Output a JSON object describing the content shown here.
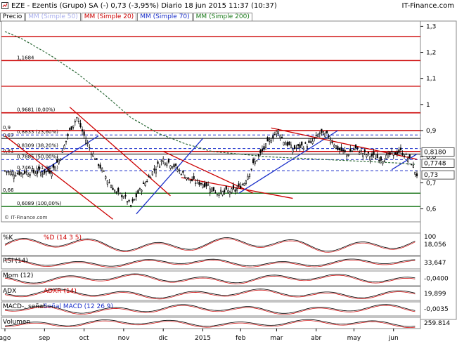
{
  "header": {
    "title": "EZE - Ezentis (Grupo) SA (-)   0,73 (-3,95%)   Diario  18 jun 2015 11:37 (10:37)",
    "brand": "IT-Finance.com"
  },
  "legend": {
    "precio": "Precio",
    "mm50": "MM (Simple 50)",
    "mm20": "MM (Simple 20)",
    "mm70": "MM (Simple 70)",
    "mm200": "MM (Simple 200)"
  },
  "colors": {
    "price": "#000000",
    "up": "#ffffff",
    "down": "#000000",
    "red": "#cc0000",
    "blue": "#1a2fc9",
    "green": "#1b7a1b",
    "mm200": "#2f6b3a",
    "label_box": "#ffffff"
  },
  "chart_data": {
    "type": "candlestick",
    "ylim": [
      0.55,
      1.32
    ],
    "yticks": [
      "1,3",
      "1,2",
      "1,1",
      "1",
      "0,9",
      "0,8",
      "0,7",
      "0,6"
    ],
    "ytick_values": [
      1.3,
      1.2,
      1.1,
      1.0,
      0.9,
      0.8,
      0.7,
      0.6
    ],
    "xticks": [
      "ago",
      "sep",
      "oct",
      "nov",
      "dic",
      "2015",
      "feb",
      "mar",
      "abr",
      "may",
      "jun"
    ],
    "xtick_index": [
      0,
      22,
      44,
      66,
      88,
      110,
      131,
      151,
      173,
      194,
      216
    ],
    "price_path": [
      [
        0,
        0.745
      ],
      [
        6,
        0.735
      ],
      [
        11,
        0.74
      ],
      [
        16,
        0.74
      ],
      [
        21,
        0.74
      ],
      [
        26,
        0.745
      ],
      [
        31,
        0.8
      ],
      [
        36,
        0.9
      ],
      [
        40,
        0.95
      ],
      [
        44,
        0.88
      ],
      [
        48,
        0.82
      ],
      [
        53,
        0.76
      ],
      [
        58,
        0.7
      ],
      [
        62,
        0.66
      ],
      [
        66,
        0.65
      ],
      [
        70,
        0.61
      ],
      [
        74,
        0.66
      ],
      [
        78,
        0.7
      ],
      [
        83,
        0.75
      ],
      [
        88,
        0.79
      ],
      [
        93,
        0.77
      ],
      [
        98,
        0.74
      ],
      [
        103,
        0.71
      ],
      [
        108,
        0.7
      ],
      [
        113,
        0.69
      ],
      [
        118,
        0.66
      ],
      [
        123,
        0.665
      ],
      [
        128,
        0.67
      ],
      [
        133,
        0.7
      ],
      [
        138,
        0.77
      ],
      [
        143,
        0.82
      ],
      [
        148,
        0.87
      ],
      [
        152,
        0.9
      ],
      [
        155,
        0.86
      ],
      [
        160,
        0.83
      ],
      [
        165,
        0.84
      ],
      [
        170,
        0.85
      ],
      [
        175,
        0.89
      ],
      [
        180,
        0.88
      ],
      [
        185,
        0.83
      ],
      [
        190,
        0.81
      ],
      [
        195,
        0.83
      ],
      [
        200,
        0.81
      ],
      [
        205,
        0.8
      ],
      [
        210,
        0.79
      ],
      [
        215,
        0.81
      ],
      [
        220,
        0.82
      ],
      [
        225,
        0.79
      ],
      [
        229,
        0.73
      ]
    ],
    "mm200_path": [
      [
        0,
        1.28
      ],
      [
        10,
        1.25
      ],
      [
        25,
        1.19
      ],
      [
        40,
        1.12
      ],
      [
        55,
        1.04
      ],
      [
        70,
        0.95
      ],
      [
        85,
        0.89
      ],
      [
        100,
        0.85
      ],
      [
        115,
        0.82
      ],
      [
        130,
        0.81
      ],
      [
        145,
        0.8
      ],
      [
        160,
        0.795
      ],
      [
        175,
        0.79
      ],
      [
        190,
        0.785
      ],
      [
        205,
        0.78
      ],
      [
        220,
        0.775
      ],
      [
        229,
        0.77
      ]
    ],
    "levels": [
      {
        "label": "1,1684",
        "value": 1.1684,
        "color": "red"
      },
      {
        "label": "0,9681 (0,00%)",
        "value": 0.9681,
        "color": "red"
      },
      {
        "label": "0,8833 (23,60%)",
        "value": 0.8833,
        "color": "blue"
      },
      {
        "label": "0,8309 (38,20%)",
        "value": 0.8309,
        "color": "blue"
      },
      {
        "label": "0,7885 (50,00%)",
        "value": 0.7885,
        "color": "blue"
      },
      {
        "label": "0,7461 (61,80%)",
        "value": 0.7461,
        "color": "blue"
      },
      {
        "label": "0,6089 (100,00%)",
        "value": 0.6089,
        "color": "green"
      }
    ],
    "plain_levels": [
      {
        "label": "0,9",
        "value": 0.9
      },
      {
        "label": "0,87",
        "value": 0.87
      },
      {
        "label": "0,81",
        "value": 0.81
      },
      {
        "label": "0,66",
        "value": 0.66
      }
    ],
    "price_tags": [
      {
        "label": "0,8180",
        "value": 0.818
      },
      {
        "label": "0,7748",
        "value": 0.7748
      },
      {
        "label": "0,73",
        "value": 0.73
      }
    ]
  },
  "indicators": [
    {
      "name": "%K",
      "legend": "%D (14 3 5)",
      "ticks": [
        "100"
      ],
      "value": "18,056"
    },
    {
      "name": "RSI (14)",
      "legend": "",
      "ticks": [],
      "value": "33,647"
    },
    {
      "name": "Mom (12)",
      "legend": "",
      "ticks": [],
      "value": "-0,0400"
    },
    {
      "name": "ADX",
      "legend": "ADXR (14)",
      "ticks": [],
      "value": "19,899"
    },
    {
      "name": "MACD-, señal",
      "legend": "Señal  MACD (12 26 9)",
      "ticks": [],
      "value": "-0,0035"
    },
    {
      "name": "Volumen",
      "legend": "",
      "ticks": [],
      "value": "259.814"
    }
  ],
  "watermark": "© IT-Finance.com"
}
